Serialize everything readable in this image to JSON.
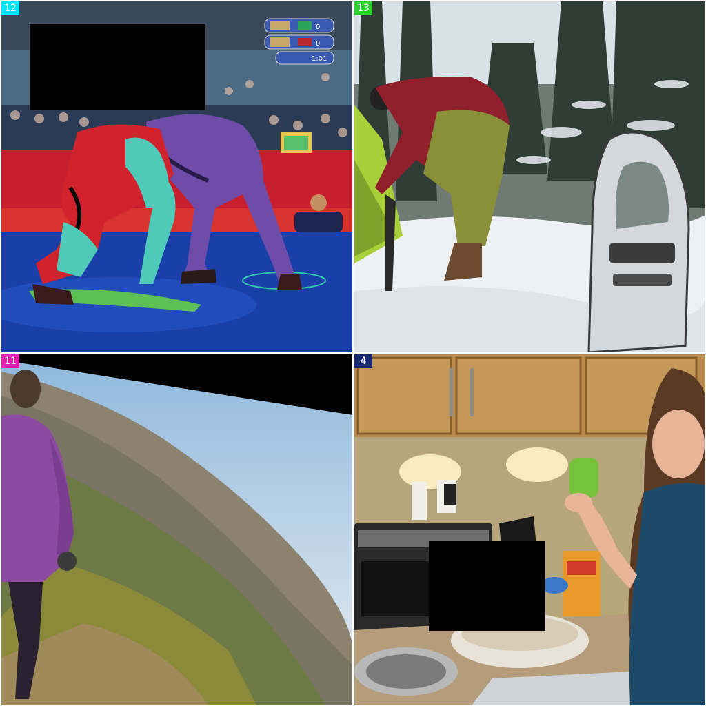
{
  "tiles": [
    {
      "id": "tile-wrestling",
      "badge": "12",
      "badge_color": "#00e5ff",
      "scene": "wrestling match, false-color filter",
      "scoreboard": [
        {
          "flag": "white-green",
          "score": "0"
        },
        {
          "flag": "red-white",
          "score": "0"
        },
        {
          "flag": "",
          "score": "1:01"
        }
      ]
    },
    {
      "id": "tile-snowshoe",
      "badge": "13",
      "badge_color": "#2fcf2f",
      "scene": "person pitching tent in snowy forest with snowshoe"
    },
    {
      "id": "tile-hiker",
      "badge": "11",
      "badge_color": "#e01fb0",
      "scene": "hiker walking on hillside trail, rotated frame"
    },
    {
      "id": "tile-kitchen",
      "badge": "4",
      "badge_color": "#1a2a6e",
      "scene": "woman in kitchen holding green sponge"
    }
  ]
}
